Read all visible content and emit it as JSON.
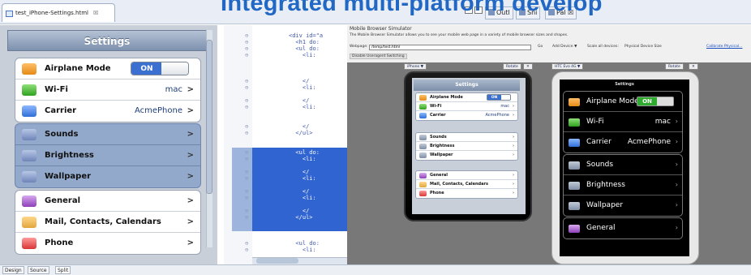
{
  "headline": "Integrated multi-platform develop",
  "editor_tab": {
    "title": "test_iPhone-Settings.html",
    "close": "☒"
  },
  "view_tabs": [
    {
      "label": "Outl"
    },
    {
      "label": "Sni"
    },
    {
      "label": "Pal"
    }
  ],
  "view_tab_close": "☒",
  "phone": {
    "nav_title": "Settings",
    "group1": [
      {
        "label": "Airplane Mode",
        "toggle": "ON",
        "icon": "airplane-icon",
        "color": "#e58a16"
      },
      {
        "label": "Wi-Fi",
        "value": "mac",
        "icon": "wifi-icon",
        "color": "#2fa21e"
      },
      {
        "label": "Carrier",
        "value": "AcmePhone",
        "icon": "carrier-icon",
        "color": "#2f6fd7"
      }
    ],
    "group2": [
      {
        "label": "Sounds",
        "icon": "sounds-icon"
      },
      {
        "label": "Brightness",
        "icon": "brightness-icon"
      },
      {
        "label": "Wallpaper",
        "icon": "wallpaper-icon"
      }
    ],
    "group3": [
      {
        "label": "General",
        "icon": "general-icon"
      },
      {
        "label": "Mail, Contacts, Calendars",
        "icon": "mail-icon"
      },
      {
        "label": "Phone",
        "icon": "phone-icon"
      }
    ],
    "chevron": ">"
  },
  "source": {
    "lines": [
      {
        "text": "<div id=\"a"
      },
      {
        "text": "  <h1 do:"
      },
      {
        "text": "  <ul do:"
      },
      {
        "text": "    <li:"
      },
      {
        "text": "    </"
      },
      {
        "text": "    <li:"
      },
      {
        "text": "    </"
      },
      {
        "text": "    <li:"
      },
      {
        "text": "    </"
      },
      {
        "text": "  </ul>"
      },
      {
        "text": "  <ul do:"
      },
      {
        "text": "    <li:"
      },
      {
        "text": "    </"
      },
      {
        "text": "    <li:"
      },
      {
        "text": "    </"
      },
      {
        "text": "    <li:"
      },
      {
        "text": "    </"
      },
      {
        "text": "  </ul>"
      },
      {
        "text": "  <ul do:"
      },
      {
        "text": "    <li:"
      }
    ]
  },
  "bottom_tabs": [
    {
      "label": "Design"
    },
    {
      "label": "Source"
    },
    {
      "label": "Split"
    }
  ],
  "simulator": {
    "title": "Mobile Browser Simulator",
    "description": "The Mobile Browser Simulator allows you to see your mobile web page in a variety of mobile browser sizes and shapes.",
    "webpage_label": "Webpage:",
    "webpage_value": "/temp/test.html",
    "go": "Go",
    "add_device": "Add Device ▼",
    "scale_label": "Scale all devices:",
    "scale_value": "Physical Device Size",
    "calibrate": "Calibrate Physical...",
    "ua_option": "Disable Useragent Switching",
    "device1": "iPhone ▼",
    "device2": "HTC Evo 4G ▼",
    "rotate": "Rotate",
    "close": "✕",
    "mini": {
      "title": "Settings",
      "g1": [
        {
          "label": "Airplane Mode",
          "toggle": "ON"
        },
        {
          "label": "Wi-Fi",
          "value": "mac"
        },
        {
          "label": "Carrier",
          "value": "AcmePhone"
        }
      ],
      "g2": [
        {
          "label": "Sounds"
        },
        {
          "label": "Brightness"
        },
        {
          "label": "Wallpaper"
        }
      ],
      "g3": [
        {
          "label": "General"
        },
        {
          "label": "Mail, Contacts, Calendars"
        },
        {
          "label": "Phone"
        }
      ]
    },
    "android": {
      "title": "Settings",
      "g1": [
        {
          "label": "Airplane Mode",
          "toggle": "ON"
        },
        {
          "label": "Wi-Fi",
          "value": "mac"
        },
        {
          "label": "Carrier",
          "value": "AcmePhone"
        }
      ],
      "g2": [
        {
          "label": "Sounds"
        },
        {
          "label": "Brightness"
        },
        {
          "label": "Wallpaper"
        }
      ],
      "g3": [
        {
          "label": "General"
        }
      ]
    }
  }
}
